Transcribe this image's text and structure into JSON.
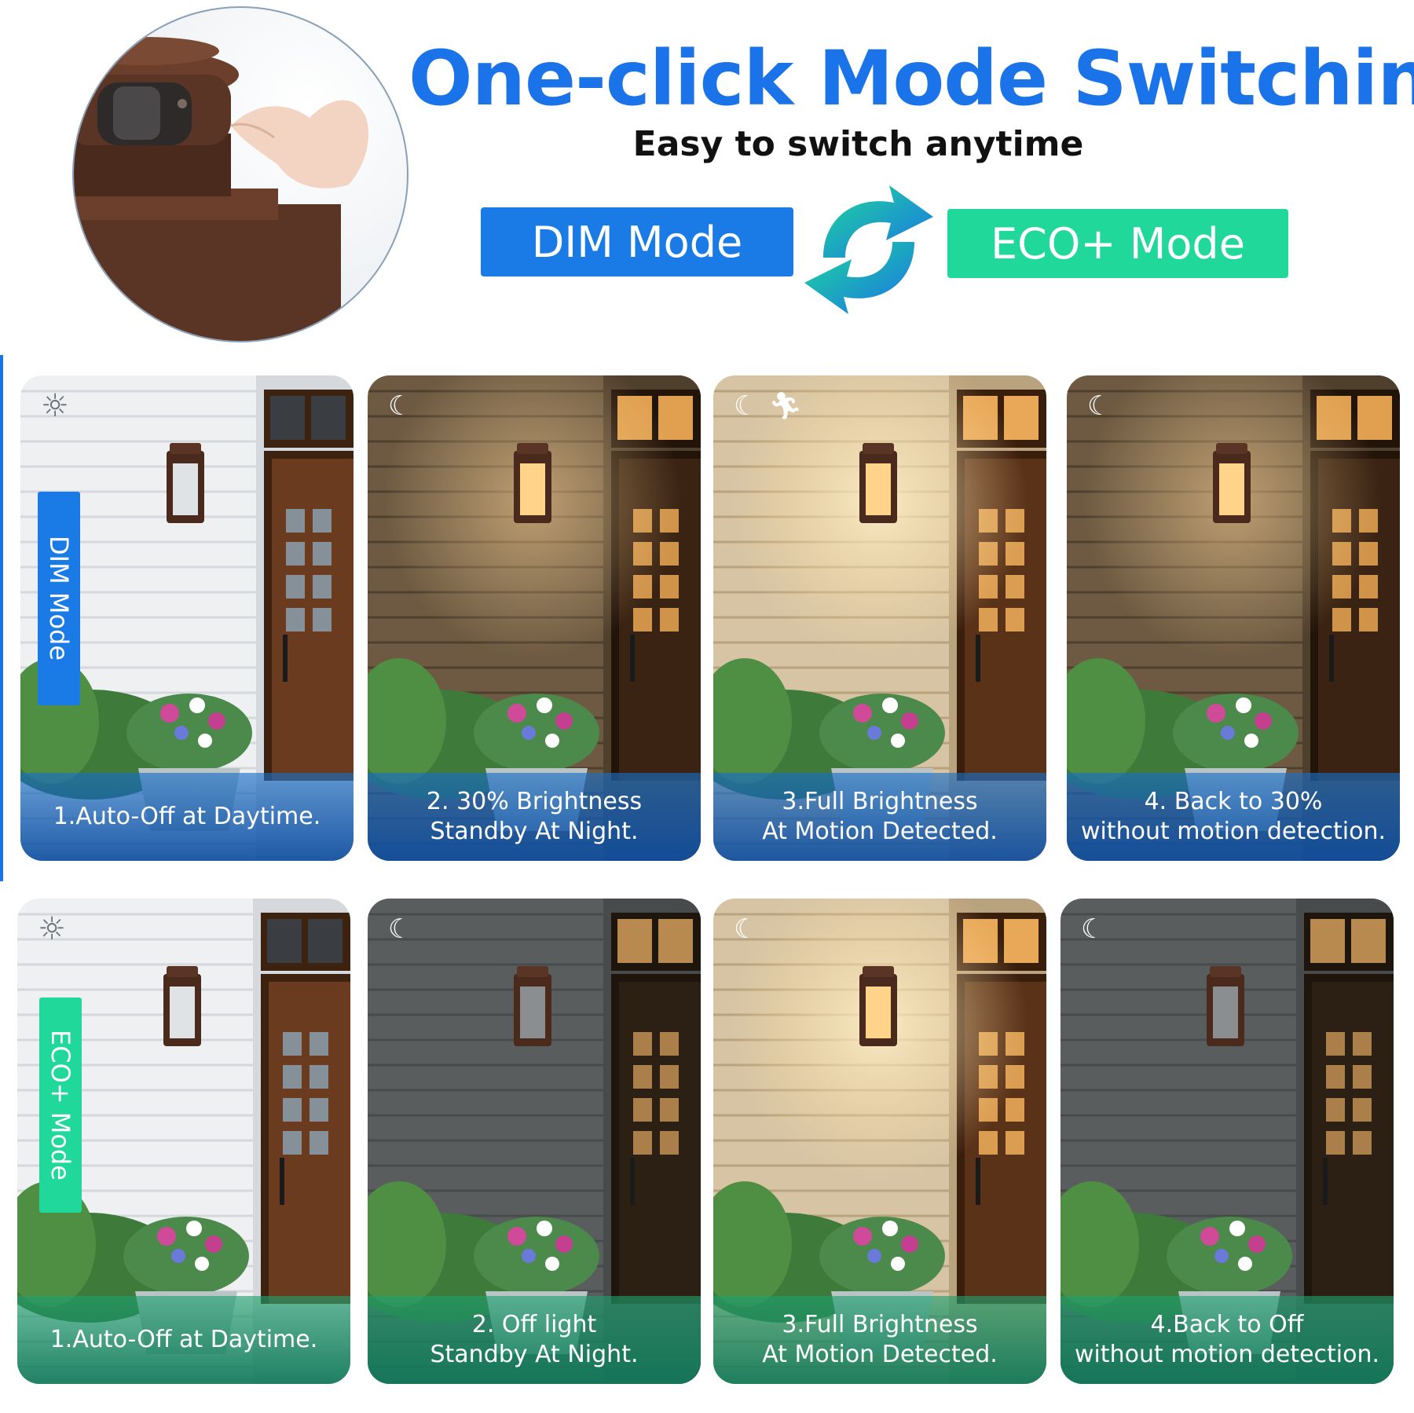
{
  "header": {
    "title": "One-click Mode Switching",
    "subtitle": "Easy to switch anytime",
    "dim_label": "DIM Mode",
    "eco_label": "ECO+ Mode"
  },
  "colors": {
    "accent_blue": "#1a73e8",
    "dim_blue": "#1a7be6",
    "eco_green": "#1fd89a"
  },
  "rows": [
    {
      "mode_tag": "DIM Mode",
      "panels": [
        {
          "caption": "1.Auto-Off at Daytime.",
          "icons": [
            "sun-icon"
          ],
          "scene": "day"
        },
        {
          "caption": "2. 30% Brightness\nStandby At Night.",
          "icons": [
            "moon-icon"
          ],
          "scene": "dim"
        },
        {
          "caption": "3.Full Brightness\nAt  Motion Detected.",
          "icons": [
            "moon-icon",
            "motion-icon"
          ],
          "scene": "bright"
        },
        {
          "caption": "4. Back to 30%\nwithout motion detection.",
          "icons": [
            "moon-icon"
          ],
          "scene": "dim"
        }
      ]
    },
    {
      "mode_tag": "ECO+ Mode",
      "panels": [
        {
          "caption": "1.Auto-Off at Daytime.",
          "icons": [
            "sun-icon"
          ],
          "scene": "day"
        },
        {
          "caption": "2. Off light\nStandby At Night.",
          "icons": [
            "moon-icon"
          ],
          "scene": "off"
        },
        {
          "caption": "3.Full Brightness\nAt  Motion Detected.",
          "icons": [
            "moon-icon"
          ],
          "scene": "bright"
        },
        {
          "caption": "4.Back to Off\nwithout motion detection.",
          "icons": [
            "moon-icon"
          ],
          "scene": "off"
        }
      ]
    }
  ]
}
